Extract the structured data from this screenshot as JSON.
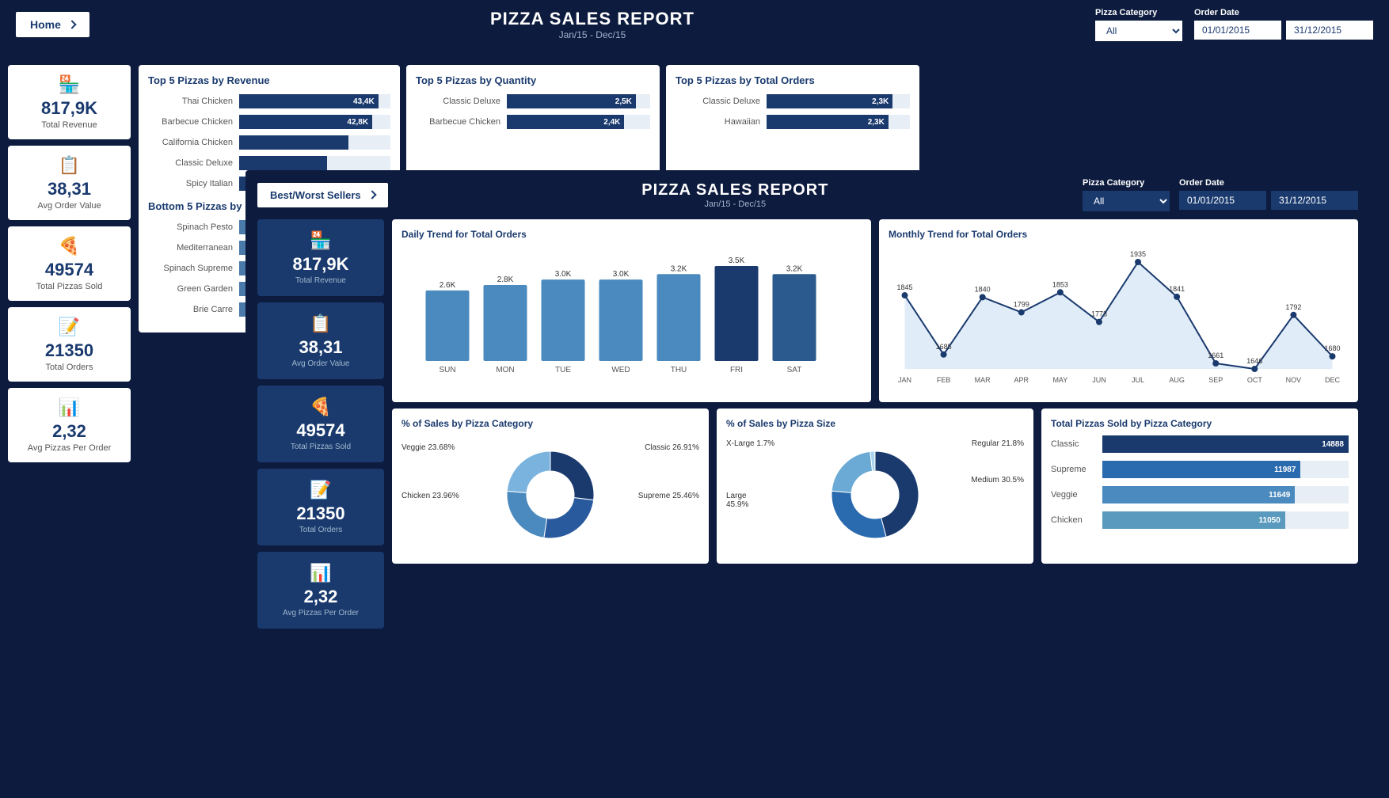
{
  "topDashboard": {
    "title": "PIZZA SALES REPORT",
    "subtitle": "Jan/15  -  Dec/15",
    "homeLabel": "Home",
    "filters": {
      "categoryLabel": "Pizza Category",
      "categoryValue": "All",
      "orderDateLabel": "Order Date",
      "dateFrom": "01/01/2015",
      "dateTo": "31/12/2015"
    }
  },
  "kpis": [
    {
      "value": "817,9K",
      "label": "Total Revenue",
      "icon": "🏪"
    },
    {
      "value": "38,31",
      "label": "Avg Order Value",
      "icon": "📋"
    },
    {
      "value": "49574",
      "label": "Total Pizzas Sold",
      "icon": "🍕"
    },
    {
      "value": "21350",
      "label": "Total Orders",
      "icon": "📝"
    },
    {
      "value": "2,32",
      "label": "Avg Pizzas Per Order",
      "icon": "📊"
    }
  ],
  "topRevenue": {
    "title": "Top 5 Pizzas by Revenue",
    "items": [
      {
        "label": "Thai Chicken",
        "value": "43,4K",
        "pct": 92
      },
      {
        "label": "Barbecue Chicken",
        "value": "42,8K",
        "pct": 88
      },
      {
        "label": "California Chicken",
        "value": "",
        "pct": 72
      },
      {
        "label": "Classic Deluxe",
        "value": "",
        "pct": 58
      },
      {
        "label": "Spicy Italian",
        "value": "",
        "pct": 44
      }
    ]
  },
  "topQuantity": {
    "title": "Top 5 Pizzas by Quantity",
    "items": [
      {
        "label": "Classic Deluxe",
        "value": "2,5K",
        "pct": 90
      },
      {
        "label": "Barbecue Chicken",
        "value": "2,4K",
        "pct": 82
      }
    ]
  },
  "topOrders": {
    "title": "Top 5 Pizzas by Total Orders",
    "items": [
      {
        "label": "Classic Deluxe",
        "value": "2,3K",
        "pct": 88
      },
      {
        "label": "Hawaiian",
        "value": "2,3K",
        "pct": 85
      }
    ]
  },
  "bottomPizzas": {
    "title": "Bottom 5 Pizzas by",
    "items": [
      {
        "label": "Spinach Pesto",
        "pct": 30
      },
      {
        "label": "Mediterranean",
        "pct": 28
      },
      {
        "label": "Spinach Supreme",
        "pct": 22
      },
      {
        "label": "Green Garden",
        "pct": 18
      },
      {
        "label": "Brie Carre",
        "pct": 12
      }
    ]
  },
  "overlay": {
    "bestWorstLabel": "Best/Worst Sellers",
    "title": "PIZZA SALES REPORT",
    "subtitle": "Jan/15  -  Dec/15",
    "filters": {
      "categoryLabel": "Pizza Category",
      "categoryValue": "All",
      "orderDateLabel": "Order Date",
      "dateFrom": "01/01/2015",
      "dateTo": "31/12/2015"
    },
    "kpis": [
      {
        "value": "817,9K",
        "label": "Total Revenue",
        "icon": "🏪"
      },
      {
        "value": "38,31",
        "label": "Avg Order Value",
        "icon": "📋"
      },
      {
        "value": "49574",
        "label": "Total Pizzas Sold",
        "icon": "🍕"
      },
      {
        "value": "21350",
        "label": "Total Orders",
        "icon": "📝"
      },
      {
        "value": "2,32",
        "label": "Avg Pizzas Per Order",
        "icon": "📊"
      }
    ],
    "dailyTrend": {
      "title": "Daily Trend for Total Orders",
      "days": [
        "SUN",
        "MON",
        "TUE",
        "WED",
        "THU",
        "FRI",
        "SAT"
      ],
      "values": [
        2600,
        2800,
        3000,
        3000,
        3200,
        3500,
        3200
      ],
      "labels": [
        "2.6K",
        "2.8K",
        "3.0K",
        "3.0K",
        "3.2K",
        "3.5K",
        "3.2K"
      ]
    },
    "monthlyTrend": {
      "title": "Monthly Trend for Total Orders",
      "months": [
        "JAN",
        "FEB",
        "MAR",
        "APR",
        "MAY",
        "JUN",
        "JUL",
        "AUG",
        "SEP",
        "OCT",
        "NOV",
        "DEC"
      ],
      "values": [
        1845,
        1685,
        1840,
        1799,
        1853,
        1773,
        1935,
        1841,
        1661,
        1646,
        1792,
        1680
      ]
    },
    "salesByCategory": {
      "title": "% of Sales by Pizza Category",
      "segments": [
        {
          "label": "Classic",
          "pct": 26.91,
          "color": "#1a3a6e"
        },
        {
          "label": "Supreme",
          "pct": 25.46,
          "color": "#2a5a9e"
        },
        {
          "label": "Chicken",
          "pct": 23.96,
          "color": "#4a8abe"
        },
        {
          "label": "Veggie",
          "pct": 23.68,
          "color": "#7ab4de"
        }
      ]
    },
    "salesBySize": {
      "title": "% of Sales by Pizza Size",
      "segments": [
        {
          "label": "Large",
          "pct": 45.9,
          "color": "#1a3a6e"
        },
        {
          "label": "Medium",
          "pct": 30.5,
          "color": "#2a6aae"
        },
        {
          "label": "Regular",
          "pct": 21.8,
          "color": "#6aaad4"
        },
        {
          "label": "X-Large",
          "pct": 1.7,
          "color": "#aad4ee"
        }
      ]
    },
    "totalByCat": {
      "title": "Total Pizzas Sold by Pizza Category",
      "items": [
        {
          "label": "Classic",
          "value": 14888,
          "color": "#1a3a6e"
        },
        {
          "label": "Supreme",
          "value": 11987,
          "color": "#2a6aae"
        },
        {
          "label": "Veggie",
          "value": 11649,
          "color": "#4a8abe"
        },
        {
          "label": "Chicken",
          "value": 11050,
          "color": "#5a9abe"
        }
      ],
      "maxValue": 14888
    }
  }
}
